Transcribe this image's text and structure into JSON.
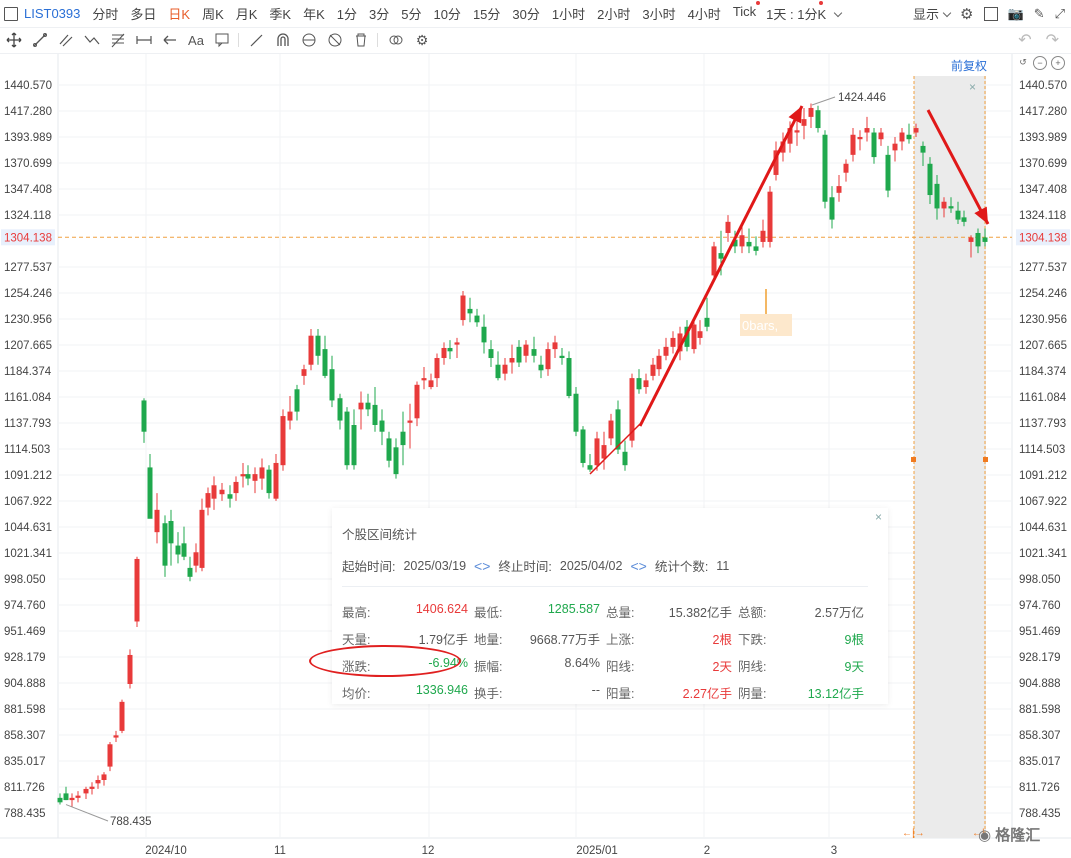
{
  "header": {
    "symbol": "LIST0393",
    "timeframes": [
      "分时",
      "多日",
      "日K",
      "周K",
      "月K",
      "季K",
      "年K",
      "1分",
      "3分",
      "5分",
      "10分",
      "15分",
      "30分",
      "1小时",
      "2小时",
      "3小时",
      "4小时",
      "Tick"
    ],
    "active_timeframe": "日K",
    "period_selector": "1天 : 1分K",
    "display_label": "显示"
  },
  "adjust_label": "前复权",
  "chart_data": {
    "type": "candlestick",
    "y_ticks": [
      "1440.570",
      "1417.280",
      "1393.989",
      "1370.699",
      "1347.408",
      "1324.118",
      "1304.138",
      "1277.537",
      "1254.246",
      "1230.956",
      "1207.665",
      "1184.374",
      "1161.084",
      "1137.793",
      "1114.503",
      "1091.212",
      "1067.922",
      "1044.631",
      "1021.341",
      "998.050",
      "974.760",
      "951.469",
      "928.179",
      "904.888",
      "881.598",
      "858.307",
      "835.017",
      "811.726",
      "788.435"
    ],
    "x_ticks": [
      "2024/10",
      "11",
      "12",
      "2025/01",
      "2",
      "3"
    ],
    "current_price": "1304.138",
    "high_label": "1424.446",
    "low_label": "788.435",
    "annotation": "0bars,",
    "up_color": "#e83a3a",
    "down_color": "#1fa84d"
  },
  "stats": {
    "title": "个股区间统计",
    "start_label": "起始时间:",
    "start_date": "2025/03/19",
    "end_label": "终止时间:",
    "end_date": "2025/04/02",
    "count_label": "统计个数:",
    "count": "11",
    "rows": [
      [
        {
          "label": "最高:",
          "value": "1406.624",
          "c": "red"
        },
        {
          "label": "最低:",
          "value": "1285.587",
          "c": "green"
        },
        {
          "label": "总量:",
          "value": "15.382亿手",
          "c": "gray"
        },
        {
          "label": "总额:",
          "value": "2.57万亿",
          "c": "gray"
        }
      ],
      [
        {
          "label": "天量:",
          "value": "1.79亿手",
          "c": "gray"
        },
        {
          "label": "地量:",
          "value": "9668.77万手",
          "c": "gray"
        },
        {
          "label": "上涨:",
          "value": "2根",
          "c": "red"
        },
        {
          "label": "下跌:",
          "value": "9根",
          "c": "green"
        }
      ],
      [
        {
          "label": "涨跌:",
          "value": "-6.94%",
          "c": "green"
        },
        {
          "label": "振幅:",
          "value": "8.64%",
          "c": "gray"
        },
        {
          "label": "阳线:",
          "value": "2天",
          "c": "red"
        },
        {
          "label": "阴线:",
          "value": "9天",
          "c": "green"
        }
      ],
      [
        {
          "label": "均价:",
          "value": "1336.946",
          "c": "green"
        },
        {
          "label": "换手:",
          "value": "--",
          "c": "gray"
        },
        {
          "label": "阳量:",
          "value": "2.27亿手",
          "c": "red"
        },
        {
          "label": "阴量:",
          "value": "13.12亿手",
          "c": "green"
        }
      ]
    ]
  },
  "watermark": "格隆汇"
}
